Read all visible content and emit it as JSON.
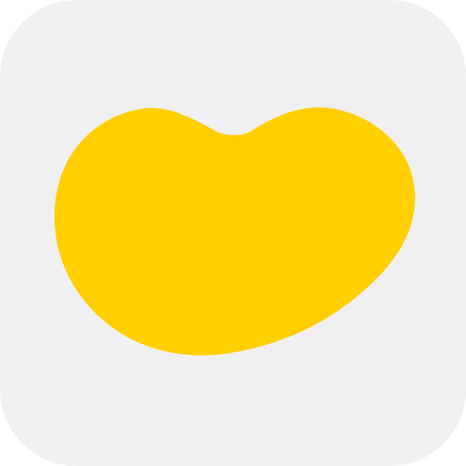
{
  "app_icon": {
    "name": "bean-app-icon",
    "icon": "bean-icon",
    "colors": {
      "background": "#f0f0f2",
      "bean": "#ffcf00"
    }
  }
}
